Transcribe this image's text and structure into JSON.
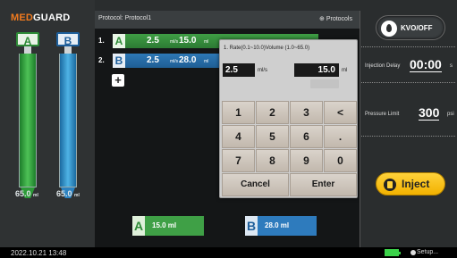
{
  "brand": {
    "part1": "MED",
    "part2": "GUARD"
  },
  "syringes": [
    {
      "label": "A",
      "volume": "65.0",
      "unit": "ml",
      "fill_level": 1.0
    },
    {
      "label": "B",
      "volume": "65.0",
      "unit": "ml",
      "fill_level": 1.0
    }
  ],
  "protocol": {
    "title": "Protocol: Protocol1",
    "menu_label": "Protocols"
  },
  "phases": [
    {
      "index": "1.",
      "syringe": "A",
      "rate": "2.5",
      "rate_unit": "ml/s",
      "volume": "15.0",
      "volume_unit": "ml"
    },
    {
      "index": "2.",
      "syringe": "B",
      "rate": "2.5",
      "rate_unit": "ml/s",
      "volume": "28.0",
      "volume_unit": "ml"
    }
  ],
  "add_phase_symbol": "+",
  "totals": [
    {
      "syringe": "A",
      "value": "15.0 ml"
    },
    {
      "syringe": "B",
      "value": "28.0 ml"
    }
  ],
  "keypad": {
    "header": "1. Rate(0.1~10.0)Volume (1.0~65.0)",
    "rate_value": "2.5",
    "rate_unit": "ml/s",
    "volume_value": "15.0",
    "volume_unit": "ml",
    "keys": [
      "1",
      "2",
      "3",
      "<",
      "4",
      "5",
      "6",
      ".",
      "7",
      "8",
      "9",
      "0"
    ],
    "cancel_label": "Cancel",
    "enter_label": "Enter"
  },
  "right": {
    "kvo_label": "KVO/OFF",
    "delay_label": "Injection Delay",
    "delay_value": "00:00",
    "delay_unit": "s",
    "pressure_label": "Pressure Limit",
    "pressure_value": "300",
    "pressure_unit": "psi",
    "inject_label": "Inject"
  },
  "footer": {
    "datetime": "2022.10.21 13:48",
    "setup_label": "Setup..."
  },
  "colors": {
    "brand_orange": "#f07a1e",
    "syringe_a": "#2d8a36",
    "syringe_b": "#1d5e9a",
    "inject": "#ffd23a",
    "battery": "#3bd24a"
  },
  "icons": [
    "kvo-drop-icon",
    "inject-icon",
    "protocols-icon",
    "battery-icon",
    "gear-icon"
  ]
}
